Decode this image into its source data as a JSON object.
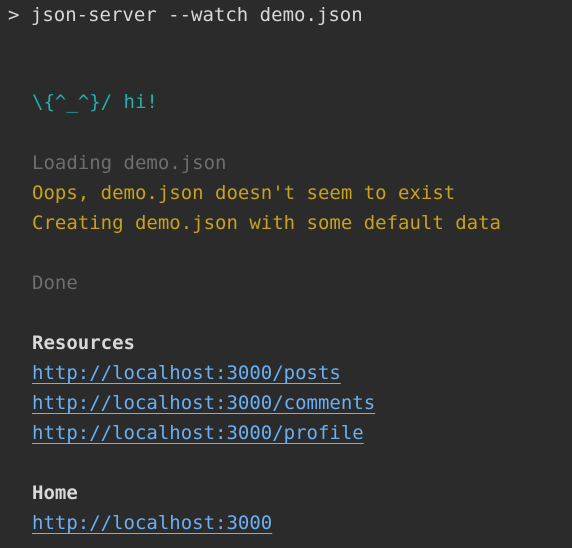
{
  "prompt": {
    "symbol": ">",
    "command": "json-server --watch demo.json"
  },
  "output": {
    "greeting": "\\{^_^}/ hi!",
    "loading": "Loading demo.json",
    "oops": "Oops, demo.json doesn't seem to exist",
    "creating": "Creating demo.json with some default data",
    "done": "Done",
    "resources_heading": "Resources",
    "resources": [
      "http://localhost:3000/posts",
      "http://localhost:3000/comments",
      "http://localhost:3000/profile"
    ],
    "home_heading": "Home",
    "home_link": "http://localhost:3000"
  },
  "colors": {
    "background": "#2b2b2b",
    "greeting": "#21b0b0",
    "muted": "#6e6e6e",
    "warning": "#c8a21a",
    "link": "#6ab0f3",
    "text": "#d8d8d8"
  }
}
